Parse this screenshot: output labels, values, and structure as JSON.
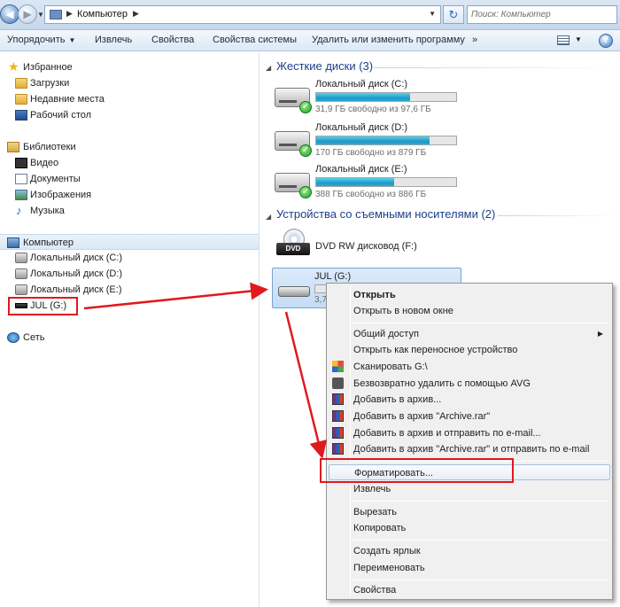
{
  "address": {
    "crumb": "Компьютер",
    "search_placeholder": "Поиск: Компьютер"
  },
  "toolbar": {
    "organize": "Упорядочить",
    "eject": "Извлечь",
    "properties": "Свойства",
    "system_properties": "Свойства системы",
    "uninstall": "Удалить или изменить программу",
    "more": "»",
    "help": "?"
  },
  "nav": {
    "favorites": "Избранное",
    "downloads": "Загрузки",
    "recent": "Недавние места",
    "desktop": "Рабочий стол",
    "libraries": "Библиотеки",
    "video": "Видео",
    "documents": "Документы",
    "images": "Изображения",
    "music": "Музыка",
    "computer": "Компьютер",
    "disk_c": "Локальный диск (C:)",
    "disk_d": "Локальный диск (D:)",
    "disk_e": "Локальный диск (E:)",
    "usb": "JUL (G:)",
    "network": "Сеть"
  },
  "content": {
    "hdd_group": "Жесткие диски (3)",
    "removable_group": "Устройства со съемными носителями (2)",
    "drives": [
      {
        "name": "Локальный диск (C:)",
        "free": "31,9 ГБ свободно из 97,6 ГБ",
        "used_fraction": 0.67
      },
      {
        "name": "Локальный диск (D:)",
        "free": "170 ГБ свободно из 879 ГБ",
        "used_fraction": 0.81
      },
      {
        "name": "Локальный диск (E:)",
        "free": "388 ГБ свободно из 886 ГБ",
        "used_fraction": 0.56
      }
    ],
    "dvd_name": "DVD RW дисковод (F:)",
    "dvd_badge": "DVD",
    "usb_name": "JUL (G:)",
    "usb_free": "3,7"
  },
  "menu": {
    "open": "Открыть",
    "open_new": "Открыть в новом окне",
    "share": "Общий доступ",
    "portable": "Открыть как переносное устройство",
    "scan": "Сканировать G:\\",
    "avg": "Безвозвратно удалить с помощью AVG",
    "archive": "Добавить в архив...",
    "archive_rar": "Добавить в архив \"Archive.rar\"",
    "archive_email": "Добавить в архив и отправить по e-mail...",
    "archive_rar_email": "Добавить в архив \"Archive.rar\" и отправить по e-mail",
    "format": "Форматировать...",
    "eject": "Извлечь",
    "cut": "Вырезать",
    "copy": "Копировать",
    "shortcut": "Создать ярлык",
    "rename": "Переименовать",
    "properties": "Свойства"
  },
  "colors": {
    "annotation_red": "#e0191f",
    "group_title": "#1e3f8a",
    "bar_fill": "#1d9ac6"
  }
}
